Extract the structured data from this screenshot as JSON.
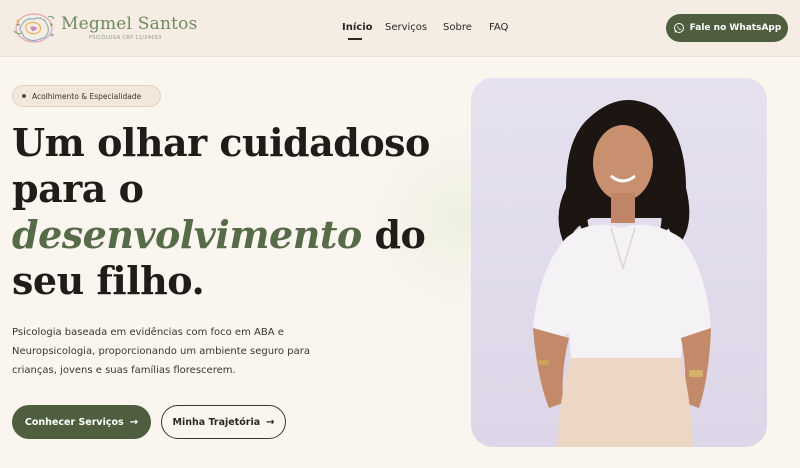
{
  "brand": {
    "name": "Megmel Santos",
    "subtitle": "PSICÓLOGA CRP 11/24693"
  },
  "nav": {
    "items": [
      {
        "label": "Início",
        "active": true
      },
      {
        "label": "Serviços",
        "active": false
      },
      {
        "label": "Sobre",
        "active": false
      },
      {
        "label": "FAQ",
        "active": false
      }
    ]
  },
  "whatsapp_button": {
    "label": "Fale no WhatsApp",
    "icon": "whatsapp-icon"
  },
  "hero": {
    "badge": "Acolhimento & Especialidade",
    "headline_part1": "Um olhar cuidadoso para o",
    "headline_accent": "desenvolvimento",
    "headline_part2": "do seu filho.",
    "description": "Psicologia baseada em evidências com foco em ABA e Neuropsicologia, proporcionando um ambiente seguro para crianças, jovens e suas famílias florescerem.",
    "primary_button": "Conhecer Serviços",
    "secondary_button": "Minha Trajetória",
    "arrow": "→"
  },
  "colors": {
    "accent_green": "#4f5e3f",
    "headline_accent": "#566b48",
    "background": "#fbf5ef",
    "header_bg": "#f5ede3",
    "photo_bg": "#e2dced"
  }
}
